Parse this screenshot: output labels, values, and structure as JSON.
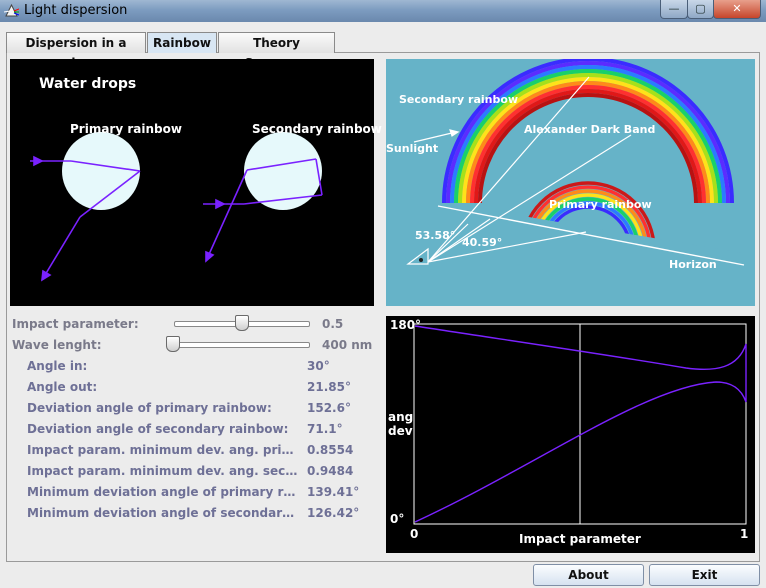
{
  "window": {
    "title": "Light dispersion"
  },
  "titlebar": {
    "minimize": "—",
    "maximize": "▢",
    "close": "✕"
  },
  "tabs": [
    {
      "label": "Dispersion in a prism"
    },
    {
      "label": "Rainbow",
      "selected": true
    },
    {
      "label": "Theory Summary"
    }
  ],
  "drops_panel": {
    "title": "Water drops",
    "primary_label": "Primary rainbow",
    "secondary_label": "Secondary rainbow"
  },
  "rainbow_panel": {
    "secondary_label": "Secondary rainbow",
    "alexander_label": "Alexander Dark Band",
    "sunlight_label": "Sunlight",
    "primary_label": "Primary rainbow",
    "angle_secondary": "53.58°",
    "angle_primary": "40.59°",
    "horizon_label": "Horizon"
  },
  "controls": {
    "impact": {
      "label": "Impact parameter:",
      "value": "0.5",
      "fraction": 0.5
    },
    "wave": {
      "label": "Wave lenght:",
      "value": "400 nm",
      "fraction": 0.0
    }
  },
  "results": [
    {
      "label": "Angle in:",
      "value": "30°"
    },
    {
      "label": "Angle out:",
      "value": "21.85°"
    },
    {
      "label": "Deviation angle of primary rainbow:",
      "value": "152.6°"
    },
    {
      "label": "Deviation angle of secondary rainbow:",
      "value": "71.1°"
    },
    {
      "label": "Impact param. minimum dev. ang. primary rain...",
      "value": "0.8554"
    },
    {
      "label": "Impact param. minimum dev. ang. secondary r...",
      "value": "0.9484"
    },
    {
      "label": "Minimum deviation angle of primary rainbow:",
      "value": "139.41°"
    },
    {
      "label": "Minimum deviation angle of secondary rainbow:",
      "value": "126.42°"
    }
  ],
  "graph": {
    "y_top": "180°",
    "y_bottom": "0°",
    "y_label_1": "ang",
    "y_label_2": "dev",
    "x_left": "0",
    "x_right": "1",
    "x_label": "Impact parameter",
    "cursor_x": 0.5
  },
  "buttons": {
    "about": "About",
    "exit": "Exit"
  },
  "colors": {
    "rainbow_bg": "#66b3c8",
    "ray": "#7a22ff",
    "drop": "#e6f9fb"
  }
}
